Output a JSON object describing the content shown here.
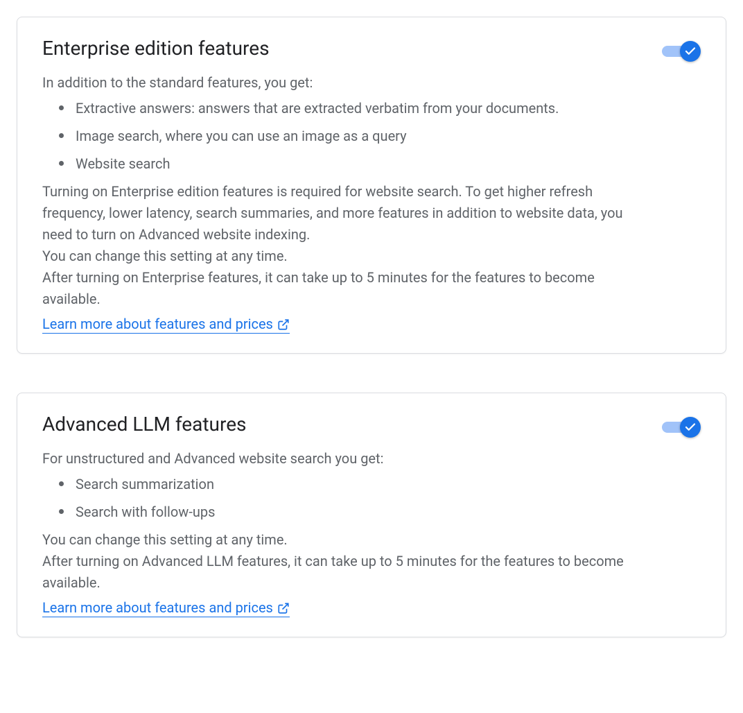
{
  "cards": [
    {
      "title": "Enterprise edition features",
      "intro": "In addition to the standard features, you get:",
      "bullets": [
        "Extractive answers: answers that are extracted verbatim from your documents.",
        "Image search, where you can use an image as a query",
        "Website search"
      ],
      "body": "Turning on Enterprise edition features is required for website search. To get higher refresh frequency, lower latency, search summaries, and more features in addition to website data, you need to turn on Advanced website indexing.\nYou can change this setting at any time.\nAfter turning on Enterprise features, it can take up to 5 minutes for the features to become available.",
      "link_label": "Learn more about features and prices",
      "toggle_on": true
    },
    {
      "title": "Advanced LLM features",
      "intro": "For unstructured and Advanced website search you get:",
      "bullets": [
        "Search summarization",
        "Search with follow-ups"
      ],
      "body": "You can change this setting at any time.\nAfter turning on Advanced LLM features, it can take up to 5 minutes for the features to become available.",
      "link_label": "Learn more about features and prices",
      "toggle_on": true
    }
  ]
}
